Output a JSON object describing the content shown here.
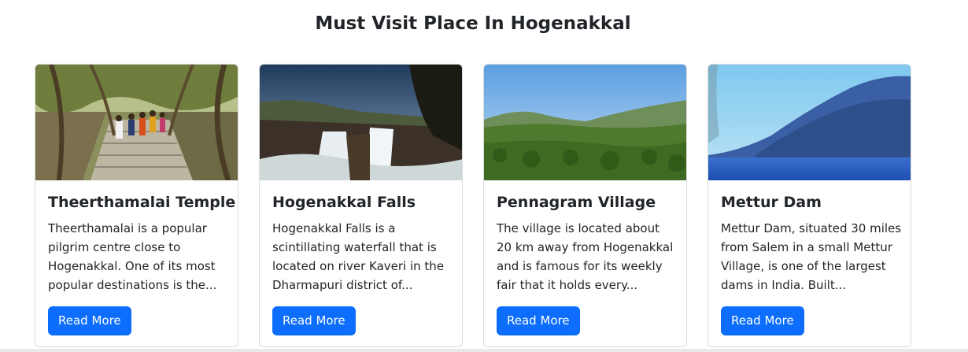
{
  "section": {
    "title": "Must Visit Place In Hogenakkal"
  },
  "cards": [
    {
      "title": "Theerthamalai Temple",
      "text": "Theerthamalai is a popular pilgrim centre close to Hogenakkal. One of its most popular destinations is the...",
      "button": "Read More"
    },
    {
      "title": "Hogenakkal Falls",
      "text": "Hogenakkal Falls is a scintillating waterfall that is located on river Kaveri in the Dharmapuri district of...",
      "button": "Read More"
    },
    {
      "title": "Pennagram Village",
      "text": "The village is located about 20 km away from Hogenakkal and is famous for its weekly fair that it holds every...",
      "button": "Read More"
    },
    {
      "title": "Mettur Dam",
      "text": "Mettur Dam, situated 30 miles from Salem in a small Mettur Village, is one of the largest dams in India. Built...",
      "button": "Read More"
    }
  ],
  "colors": {
    "button_bg": "#0d6efd",
    "button_text": "#ffffff",
    "card_border": "#dcdcdc"
  }
}
